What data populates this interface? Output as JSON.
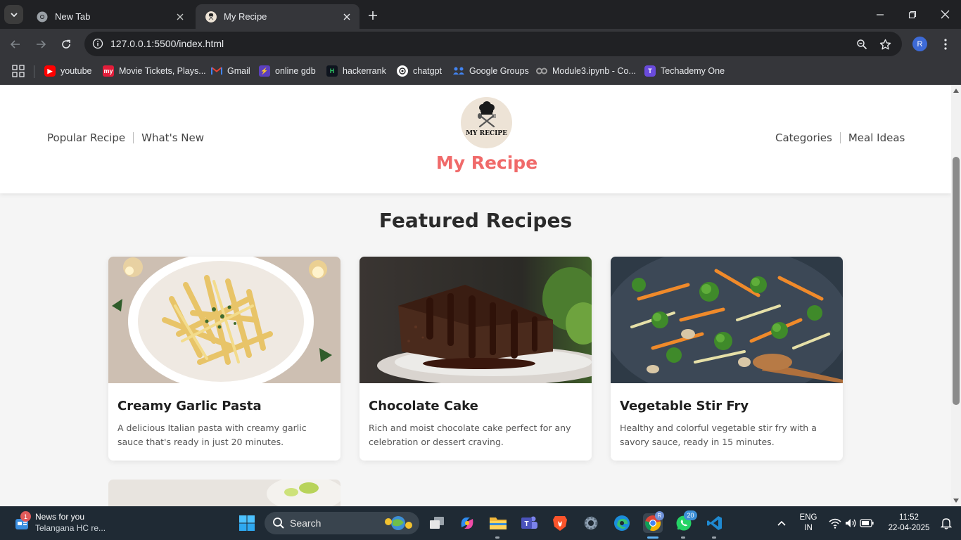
{
  "browser": {
    "tabs": [
      {
        "title": "New Tab",
        "active": false
      },
      {
        "title": "My Recipe",
        "active": true
      }
    ],
    "url": "127.0.0.1:5500/index.html",
    "profile_initial": "R",
    "bookmarks": [
      {
        "label": "youtube",
        "icon": "youtube-icon",
        "color": "#ff0000"
      },
      {
        "label": "Movie Tickets, Plays...",
        "icon": "bookmyshow-icon",
        "color": "#e21d3a"
      },
      {
        "label": "Gmail",
        "icon": "gmail-icon",
        "color": "#ea4335"
      },
      {
        "label": "online gdb",
        "icon": "onlinegdb-icon",
        "color": "#7c4dff"
      },
      {
        "label": "hackerrank",
        "icon": "hackerrank-icon",
        "color": "#0e141e"
      },
      {
        "label": "chatgpt",
        "icon": "chatgpt-icon",
        "color": "#ffffff"
      },
      {
        "label": "Google Groups",
        "icon": "google-groups-icon",
        "color": "#4285f4"
      },
      {
        "label": "Module3.ipynb - Co...",
        "icon": "colab-icon",
        "color": "#9e9e9e"
      },
      {
        "label": "Techademy One",
        "icon": "techademy-icon",
        "color": "#6a4bdc"
      }
    ]
  },
  "site": {
    "nav_left": [
      "Popular Recipe",
      "What's New"
    ],
    "nav_right": [
      "Categories",
      "Meal Ideas"
    ],
    "logo_text": "MY RECIPE",
    "brand": "My Recipe",
    "brand_color": "#f06a6a",
    "section_title": "Featured Recipes",
    "recipes": [
      {
        "title": "Creamy Garlic Pasta",
        "description": "A delicious Italian pasta with creamy garlic sauce that's ready in just 20 minutes."
      },
      {
        "title": "Chocolate Cake",
        "description": "Rich and moist chocolate cake perfect for any celebration or dessert craving."
      },
      {
        "title": "Vegetable Stir Fry",
        "description": "Healthy and colorful vegetable stir fry with a savory sauce, ready in 15 minutes."
      }
    ]
  },
  "taskbar": {
    "news_title": "News for you",
    "news_subtitle": "Telangana HC re...",
    "news_badge": "1",
    "search_label": "Search",
    "whatsapp_badge": "20",
    "chrome_badge": "R",
    "language_line1": "ENG",
    "language_line2": "IN",
    "time": "11:52",
    "date": "22-04-2025"
  }
}
